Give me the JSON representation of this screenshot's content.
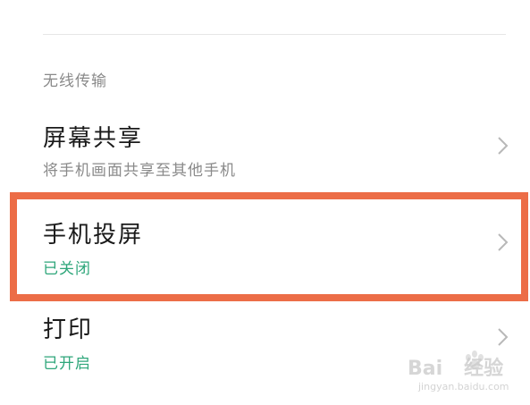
{
  "section": {
    "header": "无线传输"
  },
  "rows": [
    {
      "title": "屏幕共享",
      "subtitle": "将手机画面共享至其他手机"
    },
    {
      "title": "手机投屏",
      "subtitle": "已关闭"
    },
    {
      "title": "打印",
      "subtitle": "已开启"
    }
  ],
  "icons": {
    "chevron": "chevron-right-icon"
  },
  "colors": {
    "highlight": "#ec6d47",
    "status_green": "#2ea67a",
    "subtitle_gray": "#8a8a8a"
  },
  "watermark": {
    "brand": "Bai",
    "brand_suffix": "经验",
    "url": "jingyan.baidu.com"
  }
}
